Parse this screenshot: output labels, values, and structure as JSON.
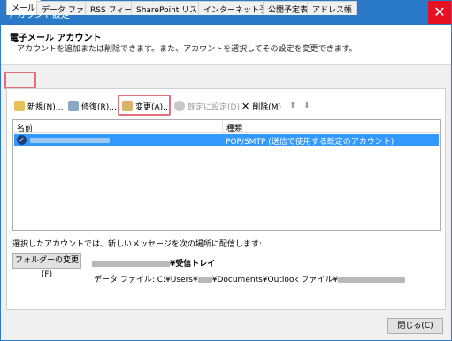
{
  "window": {
    "title": "アカウント設定",
    "close_glyph": "✕"
  },
  "header": {
    "title": "電子メール アカウント",
    "description": "アカウントを追加または削除できます。また、アカウントを選択してその設定を変更できます。"
  },
  "tabs": [
    {
      "label": "メール",
      "active": true
    },
    {
      "label": "データ ファイル"
    },
    {
      "label": "RSS フィード"
    },
    {
      "label": "SharePoint リスト"
    },
    {
      "label": "インターネット予定表"
    },
    {
      "label": "公開予定表"
    },
    {
      "label": "アドレス帳"
    }
  ],
  "toolbar": {
    "new_label": "新規(N)...",
    "repair_label": "修復(R)...",
    "change_label": "変更(A)...",
    "default_label": "既定に設定(D)",
    "delete_label": "削除(M)",
    "up_glyph": "⬆",
    "down_glyph": "⬇"
  },
  "list": {
    "headers": {
      "name": "名前",
      "type": "種類"
    },
    "rows": [
      {
        "type": "POP/SMTP (送信で使用する既定のアカウント)",
        "selected": true
      }
    ]
  },
  "delivery": {
    "label": "選択したアカウントでは、新しいメッセージを次の場所に配信します:",
    "folder_button": "フォルダーの変更(F)",
    "folder_suffix": "¥受信トレイ",
    "data_file_prefix": "データ ファイル: C:¥Users¥",
    "data_file_middle": "¥Documents¥Outlook ファイル¥"
  },
  "footer": {
    "close_label": "閉じる(C)"
  },
  "colors": {
    "titlebar": "#2b79c9",
    "selection": "#3399ff",
    "highlight": "#e2707b",
    "close": "#e81123"
  }
}
